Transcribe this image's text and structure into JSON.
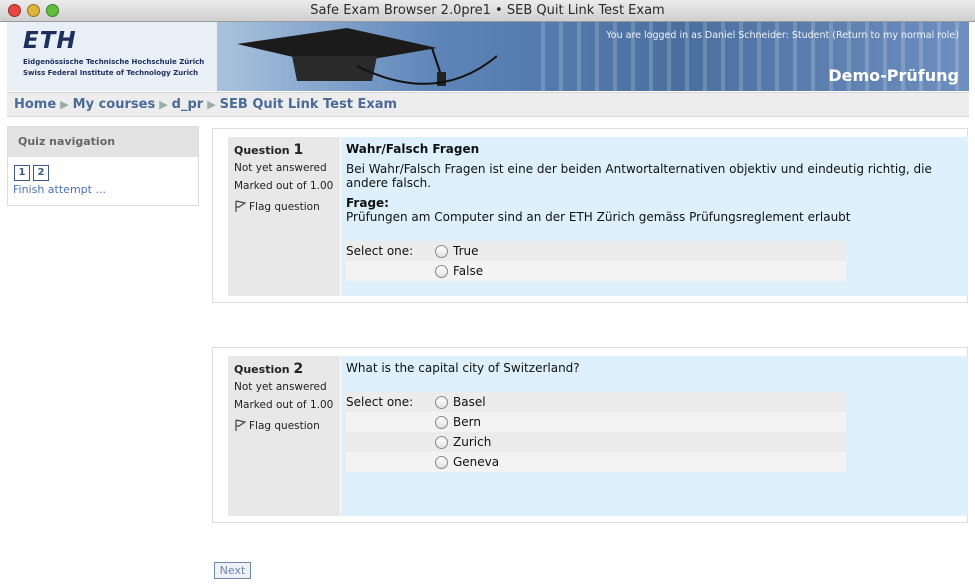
{
  "window": {
    "title": "Safe Exam Browser 2.0pre1 • SEB Quit Link Test Exam"
  },
  "header": {
    "logo": "ETH",
    "logo_line1": "Eidgenössische Technische Hochschule Zürich",
    "logo_line2": "Swiss Federal Institute of Technology Zurich",
    "login_text": "You are logged in as Daniel Schneider: Student (",
    "return_link": "Return to my normal role",
    "login_end": ")",
    "site_name": "Demo-Prüfung"
  },
  "breadcrumb": [
    "Home",
    "My courses",
    "d_pr",
    "SEB Quit Link Test Exam"
  ],
  "sidebar": {
    "title": "Quiz navigation",
    "buttons": [
      "1",
      "2"
    ],
    "finish": "Finish attempt ..."
  },
  "questions": [
    {
      "label": "Question",
      "number": "1",
      "state": "Not yet answered",
      "marks": "Marked out of 1.00",
      "flag": "Flag question",
      "heading": "Wahr/Falsch Fragen",
      "intro": "Bei Wahr/Falsch Fragen ist eine der beiden Antwortalternativen objektiv und eindeutig richtig, die andere falsch.",
      "frage_label": "Frage:",
      "text": "Prüfungen am Computer sind an der ETH Zürich gemäss Prüfungsreglement erlaubt",
      "select": "Select one:",
      "options": [
        "True",
        "False"
      ]
    },
    {
      "label": "Question",
      "number": "2",
      "state": "Not yet answered",
      "marks": "Marked out of 1.00",
      "flag": "Flag question",
      "text": "What is the capital city of Switzerland?",
      "select": "Select one:",
      "options": [
        "Basel",
        "Bern",
        "Zurich",
        "Geneva"
      ]
    }
  ],
  "next": "Next"
}
